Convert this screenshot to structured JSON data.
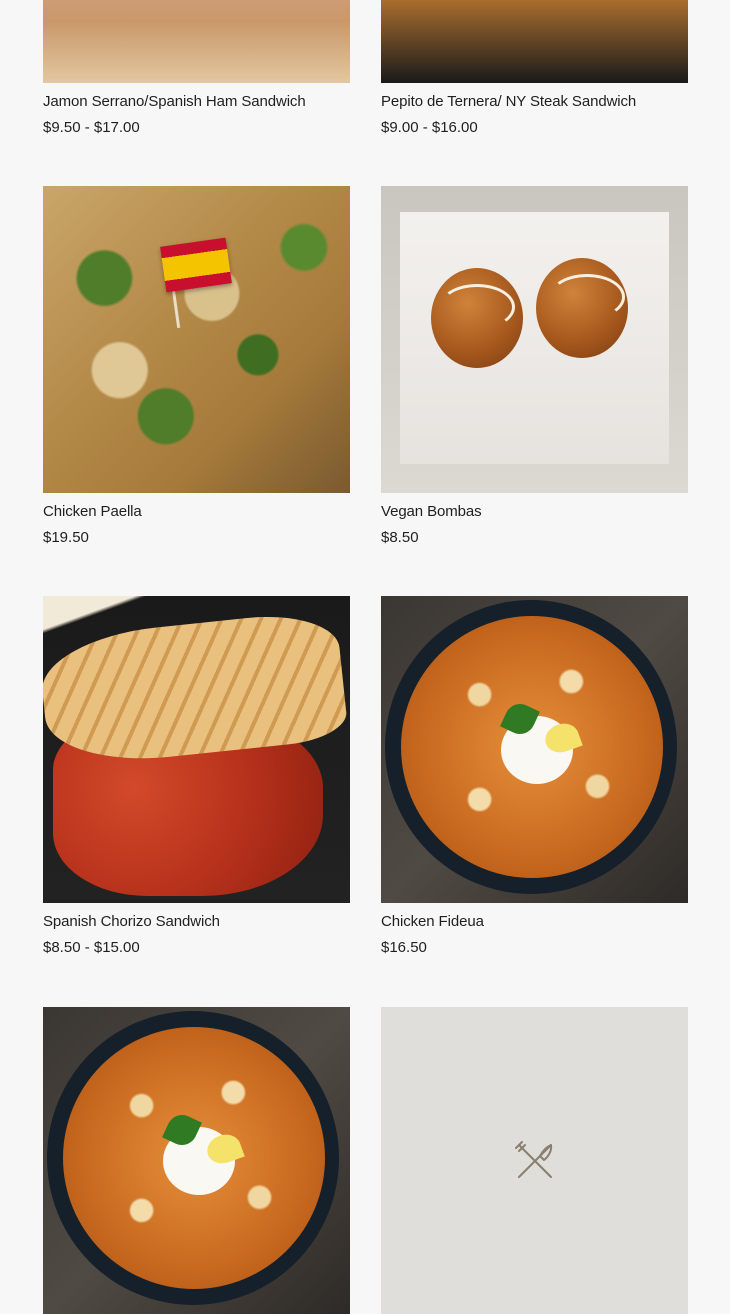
{
  "menu": {
    "items": [
      {
        "name": "Jamon Serrano/Spanish Ham Sandwich",
        "price": "$9.50 - $17.00",
        "image": "ham-sandwich-photo"
      },
      {
        "name": "Pepito de Ternera/ NY Steak Sandwich",
        "price": "$9.00 - $16.00",
        "image": "steak-sandwich-photo"
      },
      {
        "name": "Chicken Paella",
        "price": "$19.50",
        "image": "paella-photo"
      },
      {
        "name": "Vegan Bombas",
        "price": "$8.50",
        "image": "bombas-photo"
      },
      {
        "name": "Spanish Chorizo Sandwich",
        "price": "$8.50 - $15.00",
        "image": "chorizo-sandwich-photo"
      },
      {
        "name": "Chicken Fideua",
        "price": "$16.50",
        "image": "fideua-photo"
      },
      {
        "name": "",
        "price": "",
        "image": "fideua-photo"
      },
      {
        "name": "",
        "price": "",
        "image": "utensils-placeholder-icon"
      }
    ]
  },
  "colors": {
    "background": "#f7f7f7",
    "text": "#1f1f1f",
    "placeholder_bg": "#e0dedb",
    "placeholder_icon": "#8a7f6e"
  }
}
